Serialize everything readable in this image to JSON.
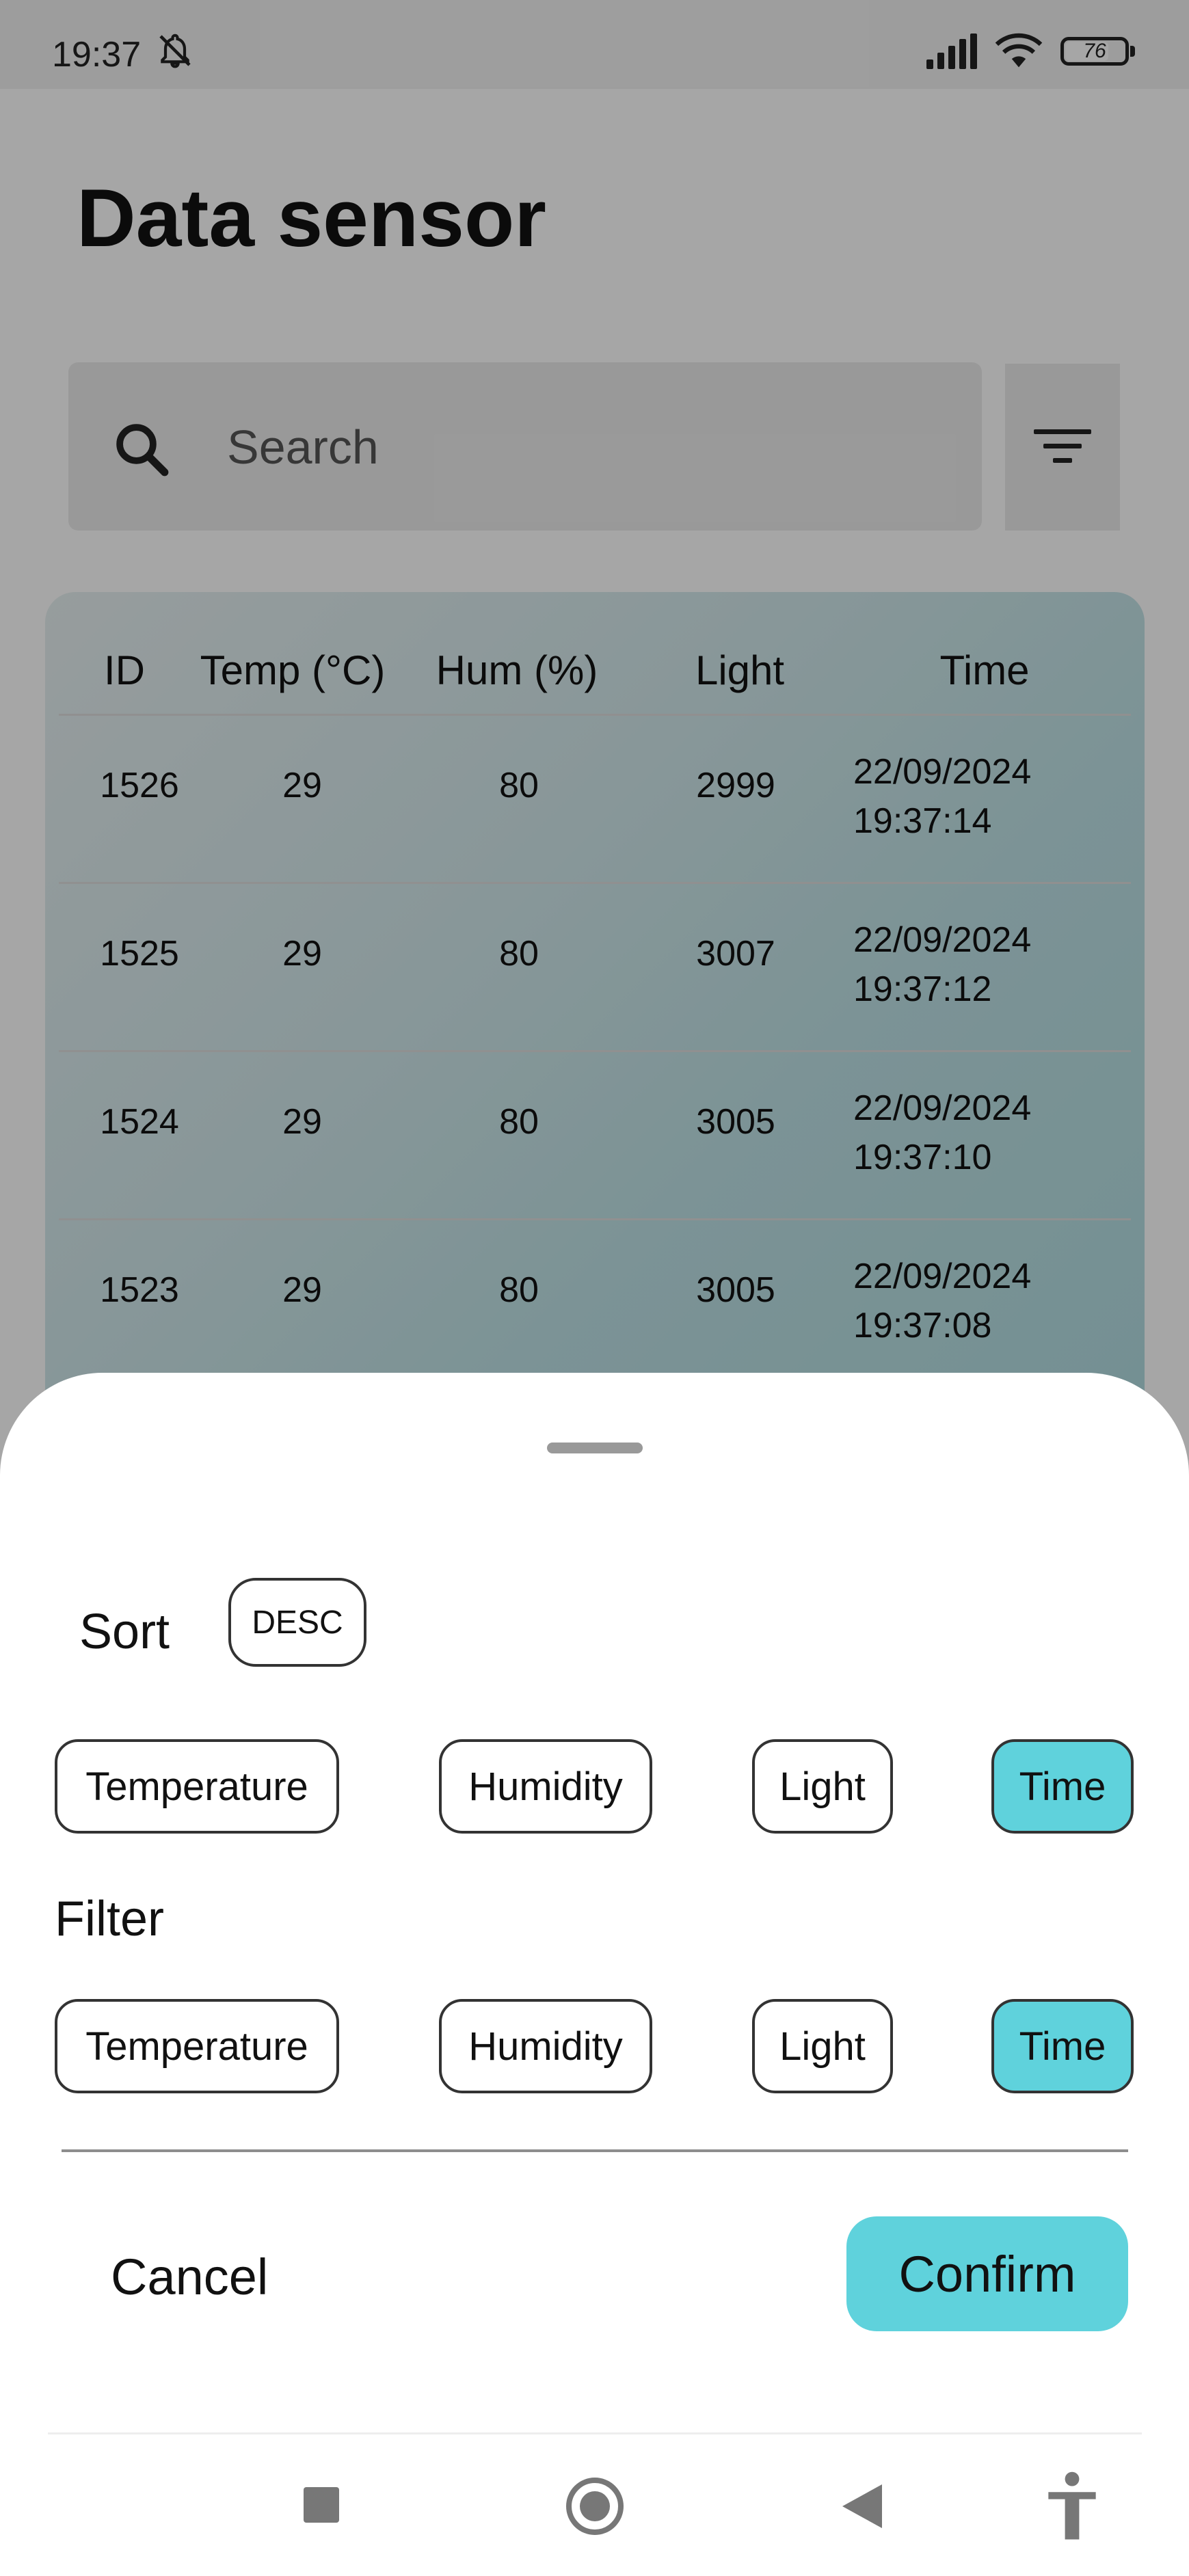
{
  "status_bar": {
    "time": "19:37",
    "battery": "76"
  },
  "header": {
    "title": "Data sensor"
  },
  "search": {
    "placeholder": "Search"
  },
  "table": {
    "columns": [
      "ID",
      "Temp (°C)",
      "Hum (%)",
      "Light",
      "Time"
    ],
    "rows": [
      {
        "id": "1526",
        "temp": "29",
        "hum": "80",
        "light": "2999",
        "date": "22/09/2024",
        "time": "19:37:14"
      },
      {
        "id": "1525",
        "temp": "29",
        "hum": "80",
        "light": "3007",
        "date": "22/09/2024",
        "time": "19:37:12"
      },
      {
        "id": "1524",
        "temp": "29",
        "hum": "80",
        "light": "3005",
        "date": "22/09/2024",
        "time": "19:37:10"
      },
      {
        "id": "1523",
        "temp": "29",
        "hum": "80",
        "light": "3005",
        "date": "22/09/2024",
        "time": "19:37:08"
      }
    ]
  },
  "sheet": {
    "sort_label": "Sort",
    "order": "DESC",
    "sort_options": [
      {
        "label": "Temperature",
        "selected": false
      },
      {
        "label": "Humidity",
        "selected": false
      },
      {
        "label": "Light",
        "selected": false
      },
      {
        "label": "Time",
        "selected": true
      }
    ],
    "filter_label": "Filter",
    "filter_options": [
      {
        "label": "Temperature",
        "selected": false
      },
      {
        "label": "Humidity",
        "selected": false
      },
      {
        "label": "Light",
        "selected": false
      },
      {
        "label": "Time",
        "selected": true
      }
    ],
    "cancel_label": "Cancel",
    "confirm_label": "Confirm"
  },
  "colors": {
    "accent": "#5fd2dc"
  }
}
